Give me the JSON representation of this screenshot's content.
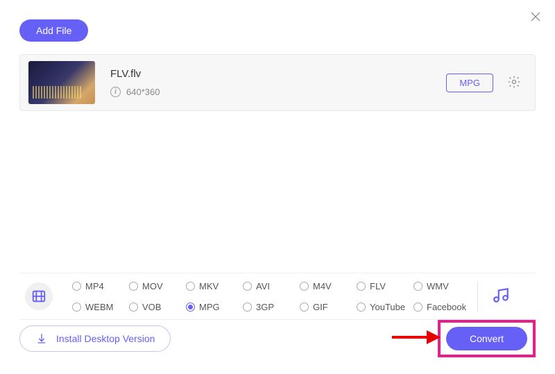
{
  "header": {
    "add_file_label": "Add File"
  },
  "file": {
    "name": "FLV.flv",
    "resolution": "640*360",
    "output_format": "MPG"
  },
  "formats": {
    "options": [
      {
        "code": "MP4",
        "selected": false
      },
      {
        "code": "MOV",
        "selected": false
      },
      {
        "code": "MKV",
        "selected": false
      },
      {
        "code": "AVI",
        "selected": false
      },
      {
        "code": "M4V",
        "selected": false
      },
      {
        "code": "FLV",
        "selected": false
      },
      {
        "code": "WMV",
        "selected": false
      },
      {
        "code": "WEBM",
        "selected": false
      },
      {
        "code": "VOB",
        "selected": false
      },
      {
        "code": "MPG",
        "selected": true
      },
      {
        "code": "3GP",
        "selected": false
      },
      {
        "code": "GIF",
        "selected": false
      },
      {
        "code": "YouTube",
        "selected": false
      },
      {
        "code": "Facebook",
        "selected": false
      }
    ]
  },
  "footer": {
    "install_label": "Install Desktop Version",
    "convert_label": "Convert"
  }
}
